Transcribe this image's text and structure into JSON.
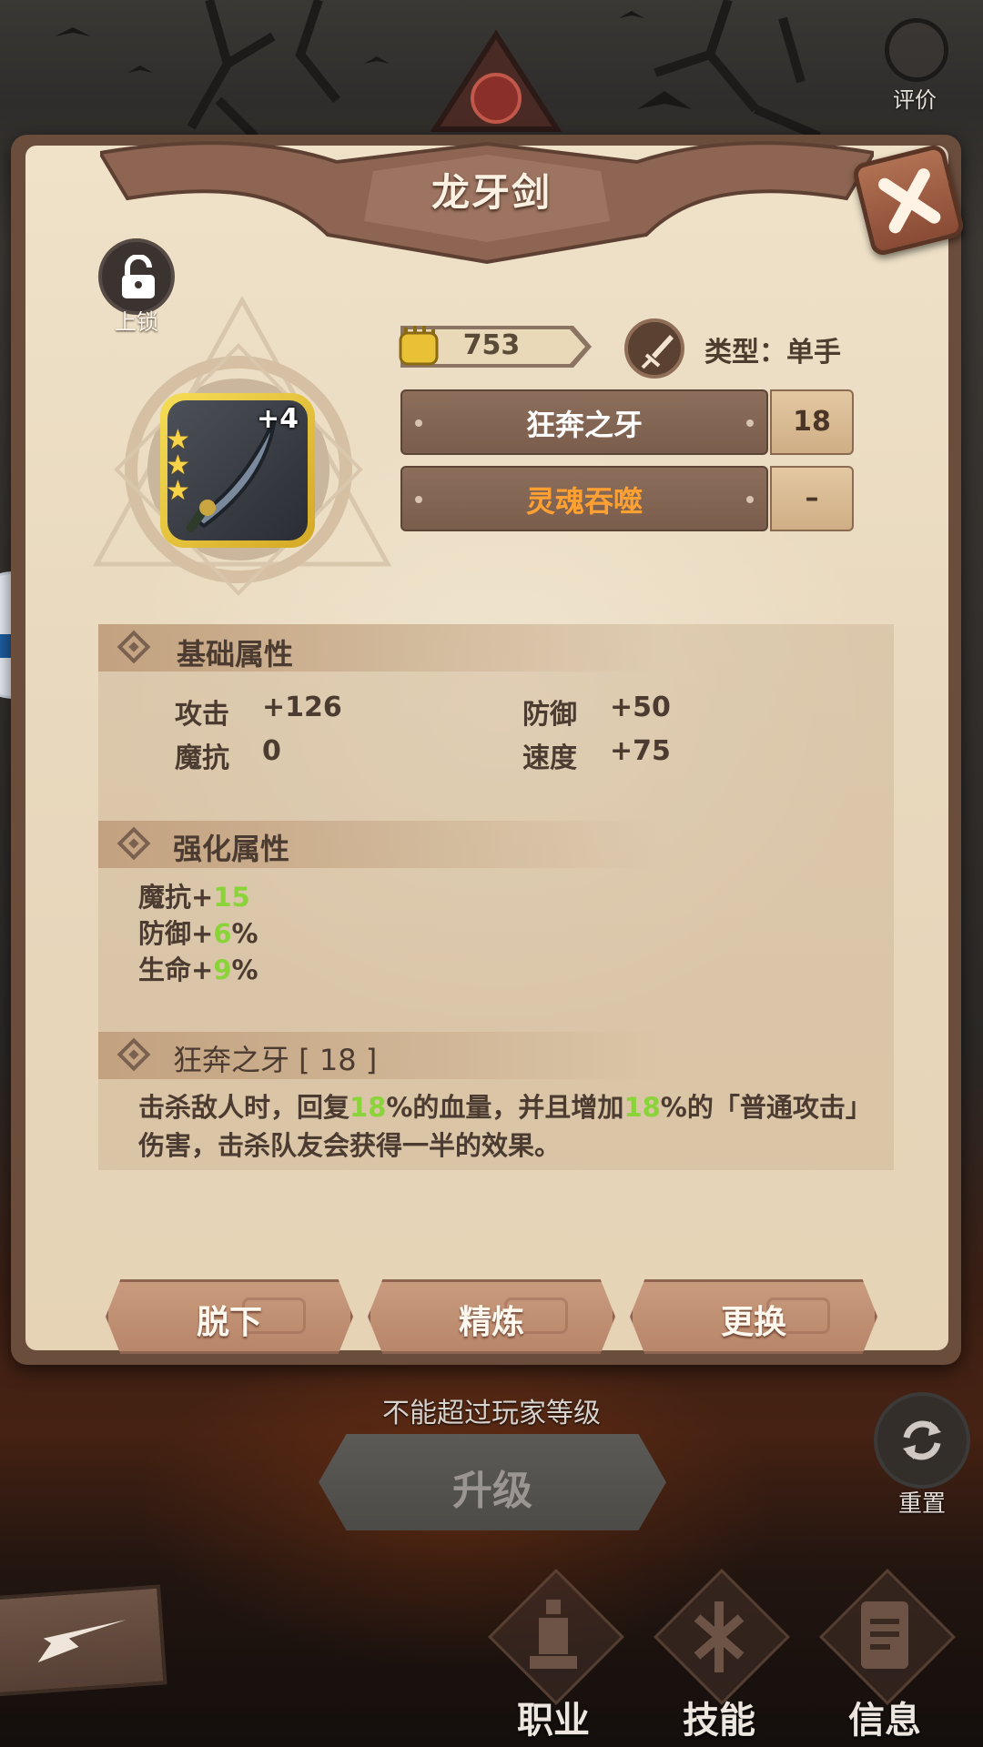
{
  "top": {
    "rate_label": "评价"
  },
  "panel": {
    "title": "龙牙剑",
    "lock_label": "上锁",
    "item": {
      "level": "+4",
      "stars": 3
    },
    "power": "753",
    "type_label": "类型：单手",
    "skills": [
      {
        "name": "狂奔之牙",
        "level": "18",
        "color": "#ffffff"
      },
      {
        "name": "灵魂吞噬",
        "level": "–",
        "color": "#ffa033"
      }
    ]
  },
  "basic": {
    "title": "基础属性",
    "stats": [
      {
        "name": "攻击",
        "value": "+126"
      },
      {
        "name": "防御",
        "value": "+50"
      },
      {
        "name": "魔抗",
        "value": "0"
      },
      {
        "name": "速度",
        "value": "+75"
      }
    ]
  },
  "enhance": {
    "title": "强化属性",
    "lines": [
      {
        "name": "魔抗+",
        "value": "15"
      },
      {
        "name": "防御+",
        "value": "6",
        "suffix": "%"
      },
      {
        "name": "生命+",
        "value": "9",
        "suffix": "%"
      }
    ]
  },
  "skill_detail": {
    "title": "狂奔之牙 [ 18 ]",
    "desc_parts": [
      "击杀敌人时，回复",
      "18",
      "%的血量，并且增加",
      "18",
      "%的「普通攻击」伤害，击杀队友会获得一半的效果。"
    ]
  },
  "actions": {
    "unequip": "脱下",
    "refine": "精炼",
    "replace": "更换"
  },
  "notice": "不能超过玩家等级",
  "upgrade": "升级",
  "reset": "重置",
  "nav": {
    "class": "职业",
    "skill": "技能",
    "info": "信息"
  },
  "colors": {
    "accent_green": "#8ad43a",
    "skill_orange": "#ffa033",
    "panel_bg": "#ecdcc2"
  }
}
